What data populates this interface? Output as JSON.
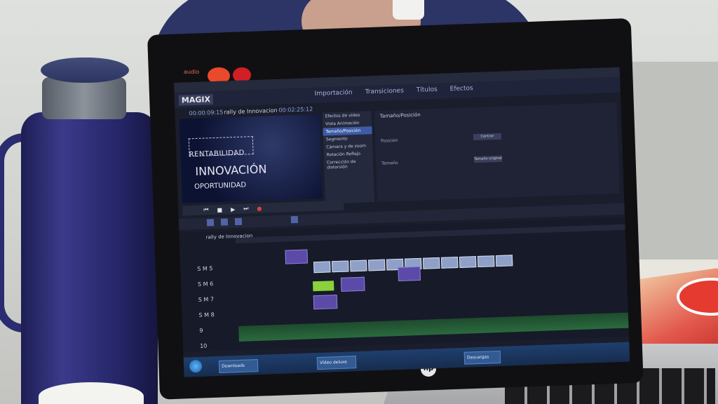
{
  "app": {
    "brand": "MAGIX",
    "sticker_text": "audio",
    "laptop_logo": "hp",
    "tabs": [
      "Importación",
      "Transiciones",
      "Títulos",
      "Efectos"
    ],
    "project_title": "rally de Innovacion",
    "time_left": "00:00:09:15",
    "time_right": "00:02:25:12"
  },
  "preview": {
    "words": [
      "RENTABILIDAD",
      "INNOVACIÓN",
      "OPORTUNIDAD"
    ]
  },
  "effects": {
    "items": [
      "Efectos de vídeo",
      "Vista Animación",
      "Tamaño/Posición",
      "Segmento",
      "Cámara y de zoom",
      "Rotación Reflejo",
      "Corrección de distorsión"
    ],
    "active_index": 2
  },
  "properties": {
    "title": "Tamaño/Posición",
    "rows": [
      "Posición",
      "Tamaño"
    ],
    "buttons": [
      "Centrar",
      "Tamaño original"
    ]
  },
  "timeline": {
    "name": "rally de Innovacion",
    "track_labels": [
      "S M 5",
      "S M 6",
      "S M 7",
      "S M 8",
      "9",
      "10"
    ]
  },
  "taskbar": {
    "items": [
      "Downloads",
      "Vídeo deluxe",
      "Descargas"
    ]
  },
  "colors": {
    "accent": "#3d5ba8",
    "clip": "#5b4aa8",
    "audio": "#2a6a3d"
  }
}
